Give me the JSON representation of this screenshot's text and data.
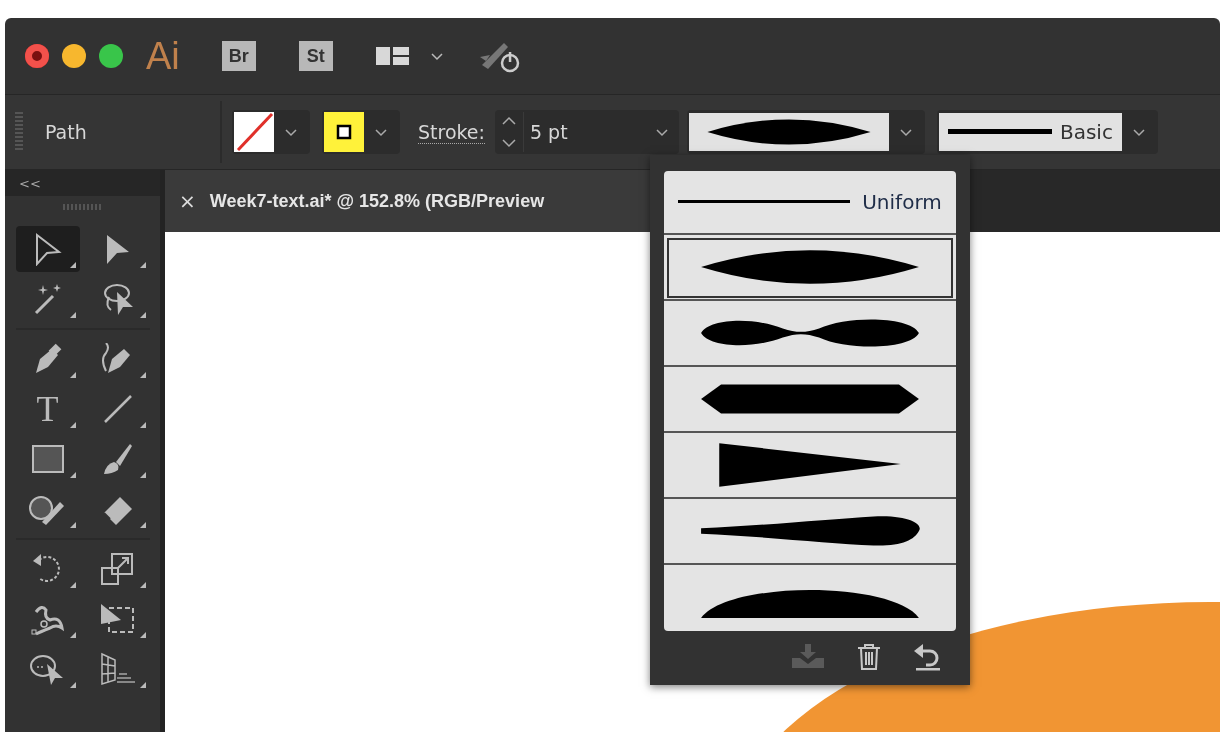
{
  "title_bar": {
    "app_logo": "Ai",
    "badges": [
      "Br",
      "St"
    ]
  },
  "control_bar": {
    "selection_label": "Path",
    "stroke_label": "Stroke:",
    "stroke_weight": "5 pt",
    "profile": {
      "kind": "lens"
    },
    "brush_label": "Basic"
  },
  "toolbar": {
    "collapse": "<<",
    "groups": [
      [
        {
          "kind": "selection",
          "selected": true
        },
        {
          "kind": "direct-selection",
          "selected": false
        },
        {
          "kind": "magic-wand",
          "selected": false
        },
        {
          "kind": "lasso",
          "selected": false
        }
      ],
      [
        {
          "kind": "pen",
          "selected": false
        },
        {
          "kind": "curvature",
          "selected": false
        },
        {
          "kind": "type",
          "glyph": "T",
          "selected": false
        },
        {
          "kind": "line",
          "selected": false
        },
        {
          "kind": "rectangle",
          "selected": false
        },
        {
          "kind": "paintbrush",
          "selected": false
        },
        {
          "kind": "shaper",
          "selected": false
        },
        {
          "kind": "eraser",
          "selected": false
        }
      ],
      [
        {
          "kind": "rotate",
          "selected": false
        },
        {
          "kind": "scale",
          "selected": false
        },
        {
          "kind": "puppet-warp",
          "selected": false
        },
        {
          "kind": "free-transform",
          "selected": false
        },
        {
          "kind": "shape-builder",
          "selected": false
        },
        {
          "kind": "perspective-grid",
          "selected": false
        }
      ]
    ]
  },
  "document_tab": {
    "close": "×",
    "title": "Week7-text.ai* @ 152.8% (RGB/Preview"
  },
  "profile_menu": {
    "items": [
      {
        "kind": "uniform",
        "label": "Uniform",
        "selected": false
      },
      {
        "kind": "lens",
        "selected": true
      },
      {
        "kind": "pinch",
        "selected": false
      },
      {
        "kind": "hexagon",
        "selected": false
      },
      {
        "kind": "taper",
        "selected": false
      },
      {
        "kind": "bulge",
        "selected": false
      },
      {
        "kind": "dome",
        "selected": false
      }
    ],
    "actions": [
      {
        "kind": "save",
        "disabled": true
      },
      {
        "kind": "delete",
        "disabled": false
      },
      {
        "kind": "reset",
        "disabled": false
      }
    ]
  }
}
